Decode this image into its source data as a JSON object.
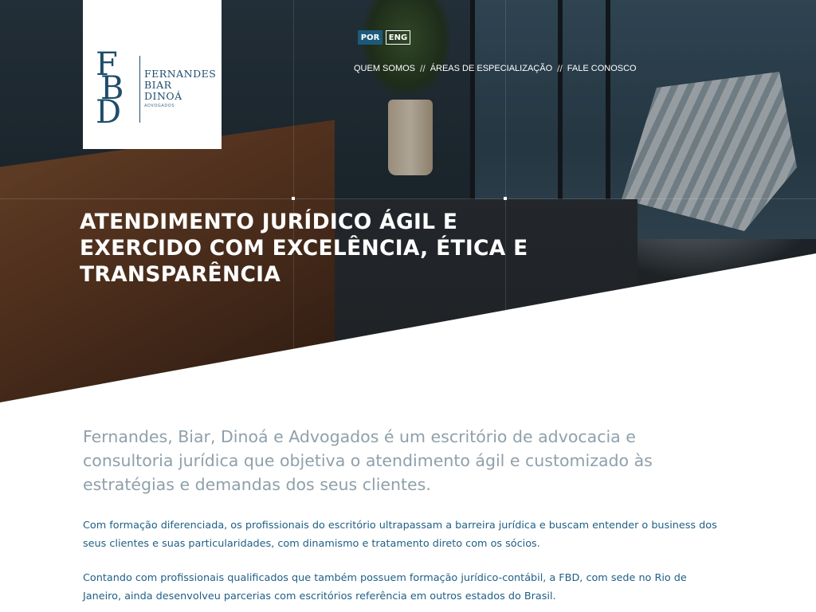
{
  "logo": {
    "monogram": [
      "F",
      "B",
      "D"
    ],
    "name_lines": [
      "FERNANDES",
      "BIAR",
      "DINOÁ"
    ],
    "subtitle": "ADVOGADOS",
    "icon": "fbd-logo-icon"
  },
  "languages": [
    {
      "label": "POR",
      "active": true
    },
    {
      "label": "ENG",
      "active": false
    }
  ],
  "nav": {
    "items": [
      "QUEM SOMOS",
      "ÁREAS DE ESPECIALIZAÇÃO",
      "FALE CONOSCO"
    ],
    "separator": "//"
  },
  "hero": {
    "title_lines": [
      "ATENDIMENTO JURÍDICO ÁGIL E",
      "EXERCIDO COM EXCELÊNCIA, ÉTICA E",
      "TRANSPARÊNCIA"
    ]
  },
  "content": {
    "lead_lines": [
      "Fernandes, Biar, Dinoá e Advogados é um escritório de advocacia e",
      "consultoria jurídica que objetiva o atendimento ágil e customizado às",
      "estratégias e demandas dos seus clientes."
    ],
    "paragraph1_lines": [
      "Com formação diferenciada, os profissionais do escritório ultrapassam a barreira jurídica e buscam entender o business dos",
      "seus clientes e suas particularidades, com dinamismo e tratamento direto com os sócios."
    ],
    "paragraph2_lines": [
      "Contando com profissionais qualificados que também possuem formação jurídico-contábil, a FBD, com sede no Rio de",
      "Janeiro, ainda desenvolveu parcerias com escritórios referência em outros estados do Brasil."
    ]
  },
  "colors": {
    "brand": "#1e4d6b",
    "active_lang": "#1d5a7a",
    "lead_text": "#8fa0ab",
    "body_text": "#1e5f86"
  }
}
